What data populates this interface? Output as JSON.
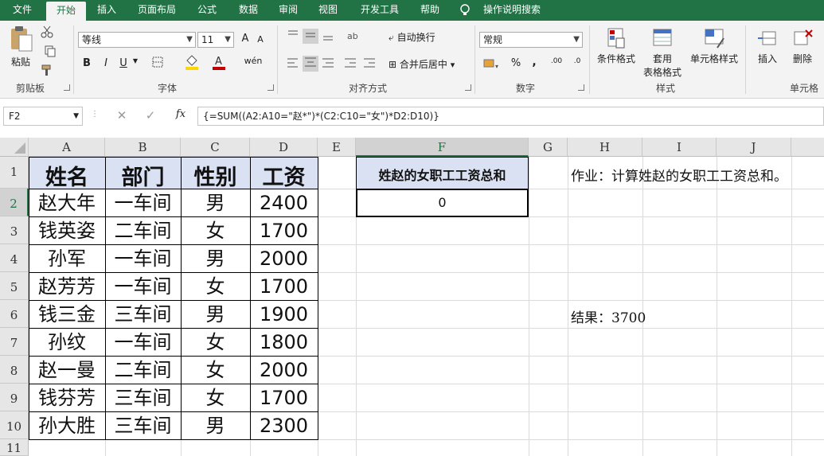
{
  "ribbon_tabs": [
    "文件",
    "开始",
    "插入",
    "页面布局",
    "公式",
    "数据",
    "审阅",
    "视图",
    "开发工具",
    "帮助",
    "操作说明搜索"
  ],
  "ribbon": {
    "clipboard": {
      "paste": "粘贴",
      "group": "剪贴板"
    },
    "font": {
      "family": "等线",
      "size": "11",
      "bold": "B",
      "italic": "I",
      "underline": "U",
      "grow": "A",
      "shrink": "A",
      "group": "字体",
      "phonetic": "wén"
    },
    "alignment": {
      "wrap": "自动换行",
      "merge": "合并后居中",
      "group": "对齐方式"
    },
    "number": {
      "format": "常规",
      "percent": "%",
      "comma": ",",
      "inc": ".00",
      "dec": ".0",
      "group": "数字"
    },
    "styles": {
      "cond": "条件格式",
      "table": "套用",
      "table2": "表格格式",
      "cellstyle": "单元格样式",
      "group": "样式"
    },
    "cells": {
      "insert": "插入",
      "delete": "删除",
      "group": "单元格"
    }
  },
  "formula_bar": {
    "name_box": "F2",
    "fx": "fx",
    "formula": "{=SUM((A2:A10=\"赵*\")*(C2:C10=\"女\")*D2:D10)}"
  },
  "columns": [
    "A",
    "B",
    "C",
    "D",
    "E",
    "F",
    "G",
    "H",
    "I",
    "J"
  ],
  "rows": [
    "1",
    "2",
    "3",
    "4",
    "5",
    "6",
    "7",
    "8",
    "9",
    "10",
    "11"
  ],
  "table": {
    "headers": [
      "姓名",
      "部门",
      "性别",
      "工资"
    ],
    "rows": [
      [
        "赵大年",
        "一车间",
        "男",
        "2400"
      ],
      [
        "钱英姿",
        "二车间",
        "女",
        "1700"
      ],
      [
        "孙军",
        "一车间",
        "男",
        "2000"
      ],
      [
        "赵芳芳",
        "一车间",
        "女",
        "1700"
      ],
      [
        "钱三金",
        "三车间",
        "男",
        "1900"
      ],
      [
        "孙纹",
        "一车间",
        "女",
        "1800"
      ],
      [
        "赵一曼",
        "二车间",
        "女",
        "2000"
      ],
      [
        "钱芬芳",
        "三车间",
        "女",
        "1700"
      ],
      [
        "孙大胜",
        "三车间",
        "男",
        "2300"
      ]
    ]
  },
  "result_box": {
    "header": "姓赵的女职工工资总和",
    "value": "0"
  },
  "notes": {
    "task": "作业：计算姓赵的女职工工资总和。",
    "result": "结果：3700"
  },
  "colors": {
    "excel_green": "#217346",
    "header_fill": "#d9e1f2",
    "font_red": "#c00000",
    "highlight_yellow": "#ffd700"
  }
}
